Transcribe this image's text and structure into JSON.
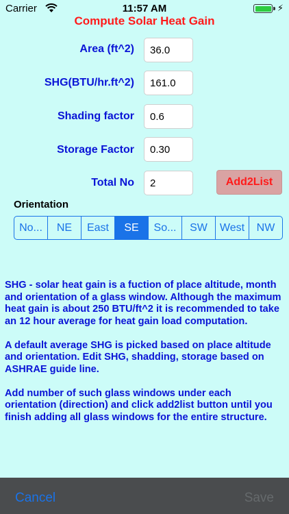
{
  "status_bar": {
    "carrier": "Carrier",
    "time": "11:57 AM",
    "wifi_icon": "wifi-icon",
    "battery_icon": "battery-icon",
    "charging_icon": "⚡",
    "battery_level": 1.0,
    "battery_color": "#2ecc40"
  },
  "title": "Compute Solar Heat Gain",
  "form": {
    "area_label": "Area (ft^2)",
    "area_value": "36.0",
    "shg_label": "SHG(BTU/hr.ft^2)",
    "shg_value": "161.0",
    "shading_label": "Shading factor",
    "shading_value": "0.6",
    "storage_label": "Storage Factor",
    "storage_value": "0.30",
    "total_label": "Total No",
    "total_value": "2",
    "add_button": "Add2List"
  },
  "orientation": {
    "label": "Orientation",
    "segments": [
      "No...",
      "NE",
      "East",
      "SE",
      "So...",
      "SW",
      "West",
      "NW"
    ],
    "selected_index": 3
  },
  "info": {
    "p1": "SHG - solar heat gain is a fuction of place altitude, month and orientation of a glass window. Although the maximum heat gain is about 250 BTU/ft^2 it is recommended to take an 12 hour average for heat gain load computation.",
    "p2": "A default average SHG is picked based on place altitude and orientation. Edit SHG, shadding, storage based on ASHRAE guide line.",
    "p3": "Add number of such glass windows under each orientation (direction) and click add2list button until you finish adding all glass windows for the entire structure."
  },
  "toolbar": {
    "cancel": "Cancel",
    "save": "Save"
  },
  "colors": {
    "background": "#ccfcf8",
    "label": "#0a14d6",
    "title": "#ff1a1a",
    "accent": "#1a73e8",
    "add_button_bg": "#d9a3a3",
    "toolbar_bg": "#4a4c4e"
  }
}
